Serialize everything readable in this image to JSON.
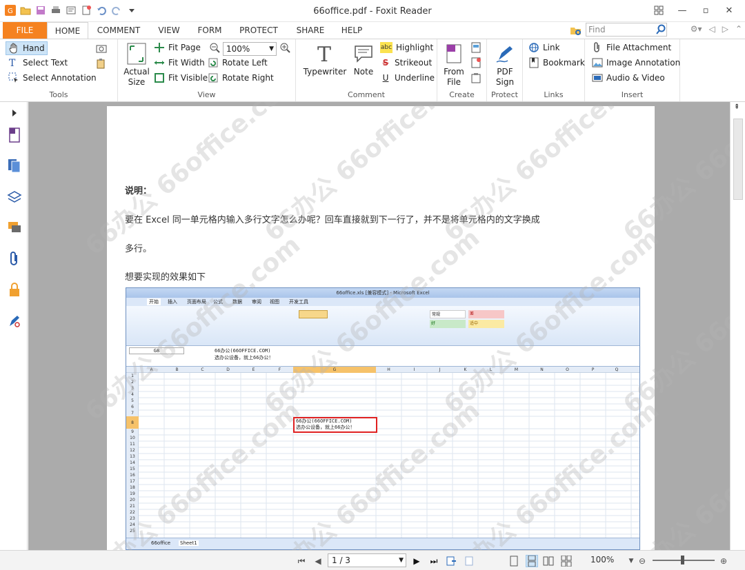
{
  "window": {
    "title": "66office.pdf - Foxit Reader"
  },
  "tabs": [
    "FILE",
    "HOME",
    "COMMENT",
    "VIEW",
    "FORM",
    "PROTECT",
    "SHARE",
    "HELP"
  ],
  "search": {
    "placeholder": "Find"
  },
  "ribbon": {
    "tools": {
      "label": "Tools",
      "hand": "Hand",
      "select_text": "Select Text",
      "select_annotation": "Select Annotation"
    },
    "view": {
      "label": "View",
      "actual_size": "Actual Size",
      "fit_page": "Fit Page",
      "fit_width": "Fit Width",
      "fit_visible": "Fit Visible",
      "zoom": "100%",
      "rotate_left": "Rotate Left",
      "rotate_right": "Rotate Right"
    },
    "comment": {
      "label": "Comment",
      "typewriter": "Typewriter",
      "note": "Note",
      "highlight": "Highlight",
      "strikeout": "Strikeout",
      "underline": "Underline"
    },
    "create": {
      "label": "Create",
      "from_file": "From File"
    },
    "protect": {
      "label": "Protect",
      "pdf_sign": "PDF Sign"
    },
    "links": {
      "label": "Links",
      "link": "Link",
      "bookmark": "Bookmark"
    },
    "insert": {
      "label": "Insert",
      "file_attachment": "File Attachment",
      "image_annotation": "Image Annotation",
      "audio_video": "Audio & Video"
    }
  },
  "document": {
    "heading": "说明：",
    "line1": "要在 Excel 同一单元格内输入多行文字怎么办呢？回车直接就到下一行了，并不是将单元格内的文字换成",
    "line2": "多行。",
    "line3": "想要实现的效果如下",
    "excel": {
      "title": "66office.xls [兼容模式] - Microsoft Excel",
      "tabs": [
        "开始",
        "插入",
        "页面布局",
        "公式",
        "数据",
        "审阅",
        "视图",
        "开发工具"
      ],
      "namebox": "G8",
      "formula_line1": "66办公(66OFFICE.COM)",
      "formula_line2": "选办公设备，就上66办公！",
      "columns": [
        "A",
        "B",
        "C",
        "D",
        "E",
        "F",
        "G",
        "H",
        "I",
        "J",
        "K",
        "L",
        "M",
        "N",
        "O",
        "P",
        "Q"
      ],
      "rows": [
        "1",
        "2",
        "3",
        "4",
        "5",
        "6",
        "7",
        "8",
        "9",
        "10",
        "11",
        "12",
        "13",
        "14",
        "15",
        "16",
        "17",
        "18",
        "19",
        "20",
        "21",
        "22",
        "23",
        "24",
        "25"
      ],
      "cell_line1": "66办公(66OFFICE.COM)",
      "cell_line2": "选办公设备，就上66办公！",
      "sheets": [
        "66office",
        "Sheet1"
      ],
      "style_cells": [
        "常规",
        "差",
        "好",
        "适中"
      ]
    },
    "watermark": "66办公 66office.com"
  },
  "status": {
    "page": "1 / 3",
    "zoom": "100%"
  }
}
